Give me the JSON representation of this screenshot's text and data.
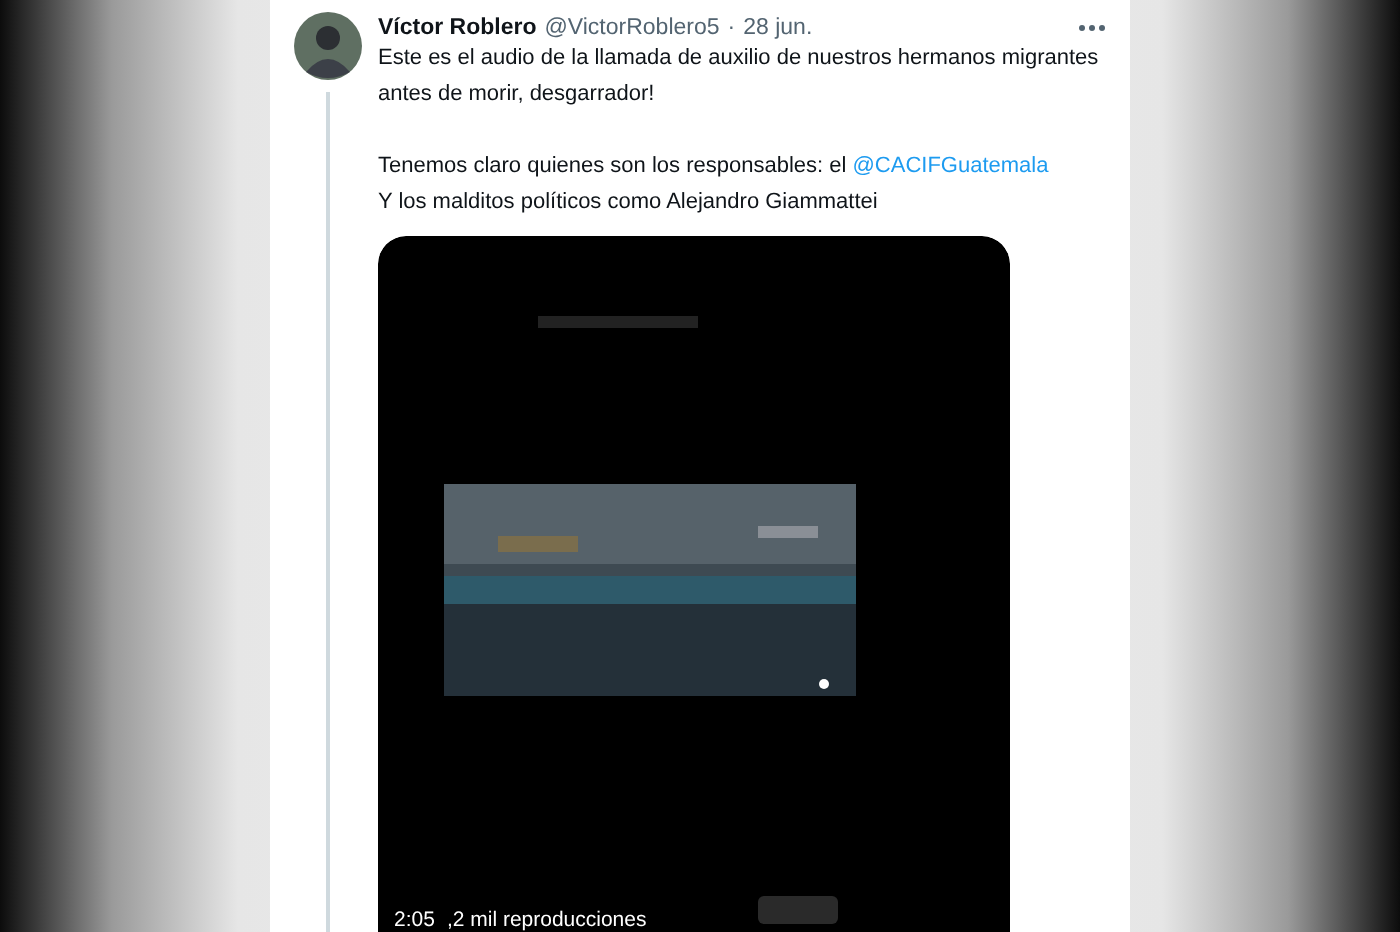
{
  "tweet": {
    "author": "Víctor Roblero",
    "handle": "@VictorRoblero5",
    "separator": "·",
    "date": "28 jun.",
    "paragraphs": [
      {
        "lines": [
          [
            {
              "kind": "text",
              "text": "Este es el audio de la llamada de auxilio de nuestros hermanos migrantes"
            }
          ],
          [
            {
              "kind": "text",
              "text": "antes de morir, desgarrador!"
            }
          ]
        ]
      },
      {
        "lines": [
          [
            {
              "kind": "text",
              "text": "Tenemos claro quienes son los responsables: el "
            },
            {
              "kind": "link",
              "text": "@CACIFGuatemala"
            }
          ],
          [
            {
              "kind": "text",
              "text": "Y los malditos políticos como Alejandro Giammattei"
            }
          ]
        ]
      }
    ],
    "video": {
      "kind": "picture",
      "duration": "2:05",
      "views": ",2 mil reproducciones"
    }
  }
}
